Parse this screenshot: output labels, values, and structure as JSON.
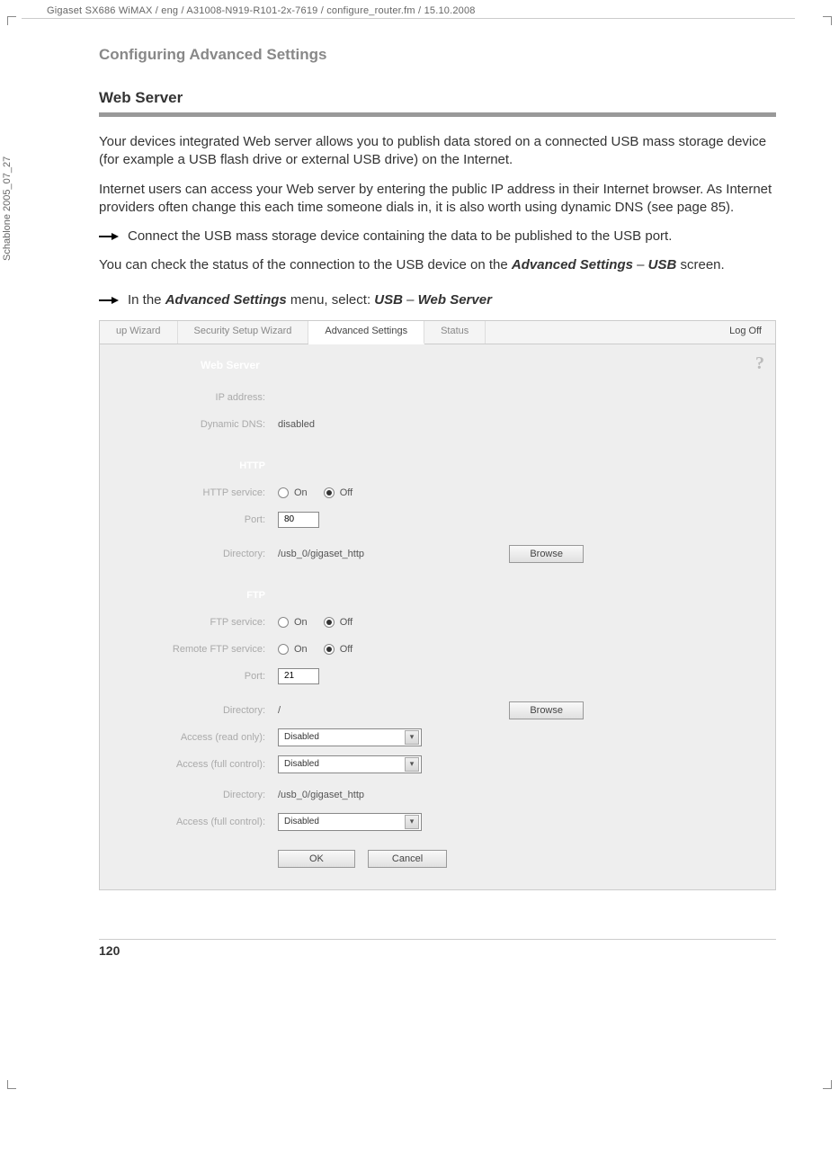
{
  "doc_header": "Gigaset SX686 WiMAX / eng / A31008-N919-R101-2x-7619 / configure_router.fm / 15.10.2008",
  "vertical_note": "Schablone 2005_07_27",
  "chapter_title": "Configuring Advanced Settings",
  "section_title": "Web Server",
  "para1": "Your devices integrated Web server allows you to publish data stored on a connected USB mass storage device (for example a USB flash drive or external USB drive) on the Internet.",
  "para2": "Internet users can access your Web server by entering the public IP address in their Internet browser. As Internet providers often change this each time someone dials in, it is also worth using dynamic DNS (see page 85).",
  "bullet1": "Connect the USB mass storage device containing the data to be published to the USB port.",
  "para3_pre": "You can check the status of the connection to the USB device on the ",
  "para3_b1": "Advanced Settings",
  "para3_mid": " – ",
  "para3_b2": "USB",
  "para3_post": " screen.",
  "bullet2_pre": "In the ",
  "bullet2_b1": "Advanced Settings",
  "bullet2_mid1": " menu, select: ",
  "bullet2_b2": "USB",
  "bullet2_mid2": " – ",
  "bullet2_b3": "Web Server",
  "tabs": {
    "t1": "up Wizard",
    "t2": "Security Setup Wizard",
    "t3": "Advanced Settings",
    "t4": "Status",
    "logoff": "Log Off"
  },
  "panel": {
    "title": "Web Server",
    "ip_label": "IP address:",
    "dns_label": "Dynamic DNS:",
    "dns_value": "disabled",
    "http_head": "HTTP",
    "http_service_label": "HTTP service:",
    "on": "On",
    "off": "Off",
    "port_label": "Port:",
    "http_port": "80",
    "dir_label": "Directory:",
    "http_dir": "/usb_0/gigaset_http",
    "browse": "Browse",
    "ftp_head": "FTP",
    "ftp_service_label": "FTP service:",
    "remote_ftp_label": "Remote FTP service:",
    "ftp_port": "21",
    "ftp_dir1": "/",
    "access_ro_label": "Access (read only):",
    "access_fc_label": "Access (full control):",
    "disabled_opt": "Disabled",
    "ftp_dir2": "/usb_0/gigaset_http",
    "ok": "OK",
    "cancel": "Cancel",
    "help": "?"
  },
  "page_number": "120"
}
